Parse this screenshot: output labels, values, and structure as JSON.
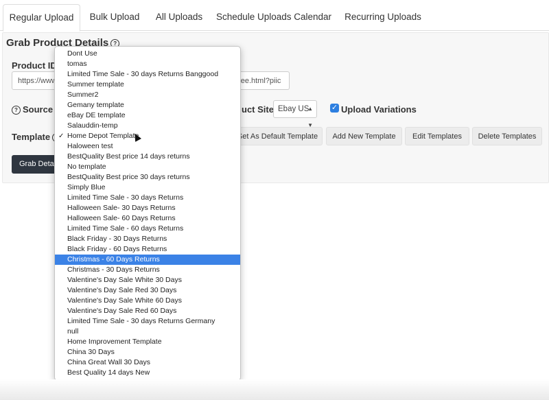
{
  "tabs": [
    {
      "label": "Regular Upload",
      "active": true
    },
    {
      "label": "Bulk Upload"
    },
    {
      "label": "All Uploads"
    },
    {
      "label": "Schedule Uploads Calendar"
    },
    {
      "label": "Recurring Uploads"
    }
  ],
  "panel": {
    "title": "Grab Product Details",
    "product_id_label": "Product ID",
    "url_left": "https://www",
    "url_right": "tree.html?piic",
    "source_label": "Source I",
    "product_site_label": "uct Site",
    "product_site_value": "Ebay US",
    "upload_variations_label": "Upload Variations",
    "template_label": "Template",
    "buttons": {
      "set_default": "Set As Default Template",
      "add_new": "Add New Template",
      "edit": "Edit Templates",
      "delete": "Delete Templates"
    },
    "grab_button": "Grab Deta"
  },
  "dropdown": {
    "checked_item": "Home Depot Template",
    "highlighted_item": "Christmas - 60 Days Returns",
    "items": [
      "Dont Use",
      "tomas",
      "Limited Time Sale - 30 days Returns Banggood",
      "Summer template",
      "Summer2",
      "Gemany template",
      "eBay DE template",
      "Salauddin-temp",
      "Home Depot Template",
      "Haloween test",
      "BestQuality Best price 14 days returns",
      "No template",
      "BestQuality Best price 30 days returns",
      "Simply Blue",
      "Limited Time Sale - 30 days Returns",
      "Halloween Sale- 30 Days Returns",
      "Halloween Sale- 60 Days Returns",
      "Limited Time Sale - 60 days Returns",
      "Black Friday - 30 Days Returns",
      "Black Friday - 60 Days Returns",
      "Christmas - 60 Days Returns",
      "Christmas - 30 Days Returns",
      "Valentine's Day Sale White 30 Days",
      "Valentine's Day Sale Red 30 Days",
      "Valentine's Day Sale White 60 Days",
      "Valentine's Day Sale Red 60 Days",
      "Limited Time Sale - 30 days Returns Germany",
      "null",
      "Home Improvement Template",
      "China 30 Days",
      "China Great Wall 30 Days",
      "Best Quality 14 days New"
    ]
  }
}
